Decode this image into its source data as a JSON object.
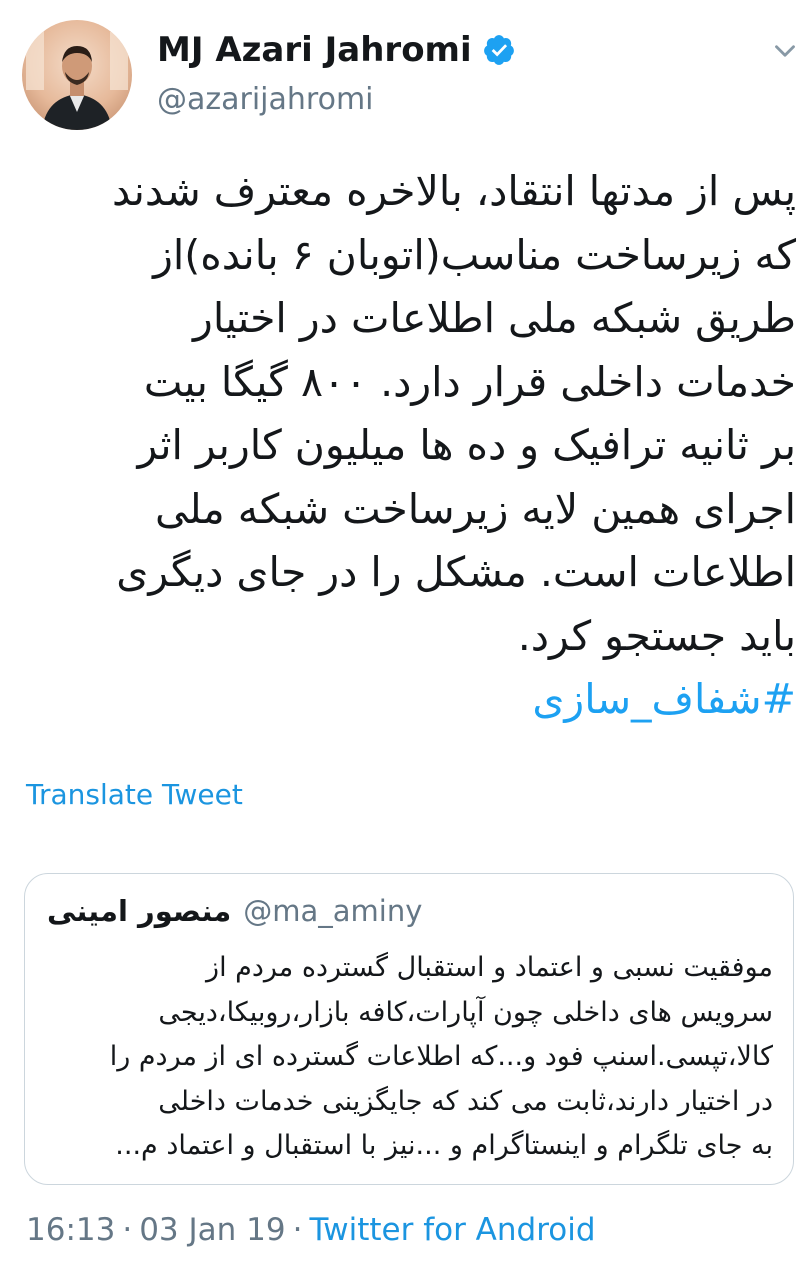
{
  "author": {
    "display_name": "MJ Azari Jahromi",
    "handle": "@azarijahromi",
    "verified": true
  },
  "tweet": {
    "lines": [
      "پس از مدتها انتقاد، بالاخره معترف شدند",
      "که زیرساخت مناسب(اتوبان ۶ بانده)از",
      "طریق شبکه ملی اطلاعات در اختیار",
      "خدمات داخلی قرار دارد. ۸۰۰ گیگا بیت",
      "بر ثانیه ترافیک و ده ها میلیون کاربر اثر",
      "اجرای همین لایه زیرساخت شبکه ملی",
      "اطلاعات است. مشکل را در جای دیگری",
      "باید جستجو کرد."
    ],
    "hashtag": "#شفاف_سازی"
  },
  "translate_label": "Translate Tweet",
  "quoted": {
    "name": "منصور امینی",
    "handle": "@ma_aminy",
    "lines": [
      "موفقیت نسبی و اعتماد و استقبال گسترده مردم از",
      "سرویس های داخلی چون آپارات،کافه بازار،روبیکا،دیجی",
      "کالا،تپسی.اسنپ فود و...که اطلاعات گسترده ای از مردم را",
      "در اختیار دارند،ثابت می کند که جایگزینی خدمات داخلی",
      "به جای تلگرام و اینستاگرام و ...نیز با استقبال و اعتماد م..."
    ]
  },
  "footer": {
    "time": "16:13",
    "date": "03 Jan 19",
    "separator": "·",
    "source": "Twitter for Android"
  },
  "colors": {
    "link": "#1b95e0",
    "hashtag": "#1da1f2",
    "verified_badge": "#1da1f2",
    "muted": "#657786",
    "border": "#ccd6dd"
  },
  "icons": {
    "verified": "verified-badge-icon",
    "menu": "chevron-down-icon"
  }
}
